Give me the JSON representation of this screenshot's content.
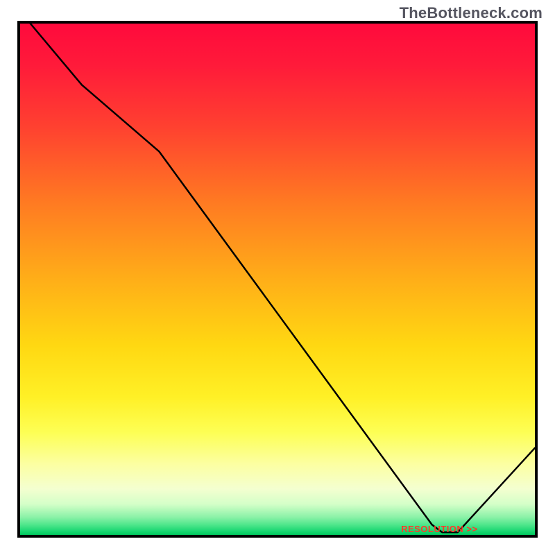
{
  "watermark": "TheBottleneck.com",
  "annotation_label": "RESOLUTION >>",
  "chart_data": {
    "type": "line",
    "title": "",
    "xlabel": "",
    "ylabel": "",
    "xlim": [
      0,
      100
    ],
    "ylim": [
      0,
      100
    ],
    "series": [
      {
        "name": "curve",
        "x": [
          2,
          12,
          27,
          80,
          82,
          85,
          100
        ],
        "y": [
          100,
          88,
          75,
          2,
          0.5,
          0.5,
          17
        ]
      }
    ],
    "annotations": [
      {
        "text": "RESOLUTION >>",
        "x": 78,
        "y": 1
      }
    ],
    "background_gradient": {
      "top": "#ff0a3c",
      "mid": "#ffd812",
      "bottom": "#00c95e"
    }
  }
}
